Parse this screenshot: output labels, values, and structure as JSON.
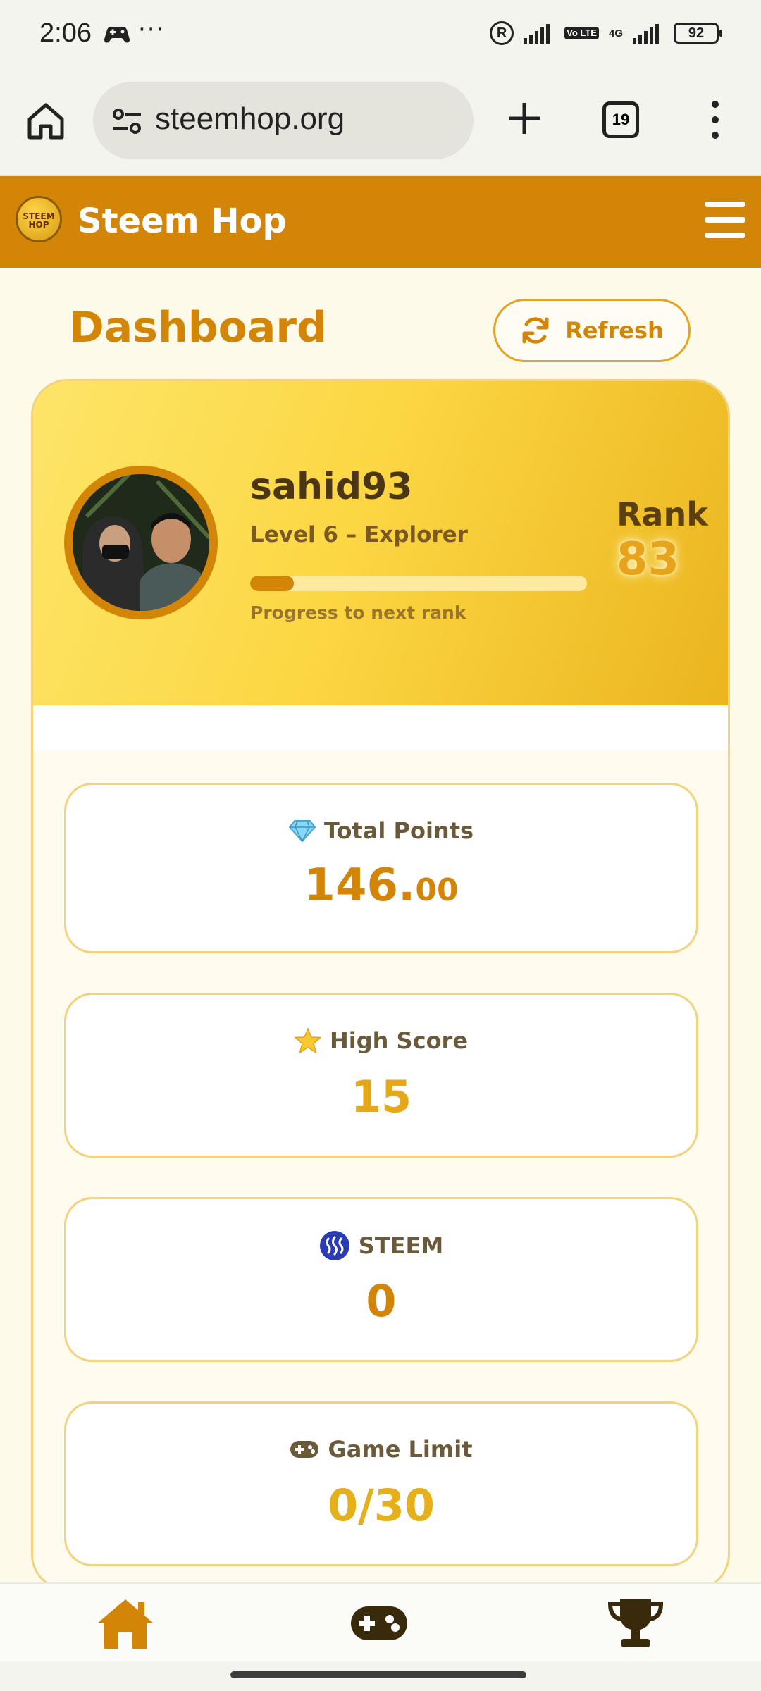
{
  "status_bar": {
    "time": "2:06",
    "dots": "···",
    "network": "4G",
    "volte": "Vo LTE",
    "battery": "92"
  },
  "browser": {
    "url": "steemhop.org",
    "tab_count": "19"
  },
  "app": {
    "title": "Steem Hop",
    "logo_text": "STEEM HOP",
    "brand_color": "#d38507"
  },
  "dashboard": {
    "title": "Dashboard",
    "refresh_label": "Refresh"
  },
  "profile": {
    "username": "sahid93",
    "level": "Level 6 – Explorer",
    "progress_label": "Progress to next rank",
    "progress_fraction": 0.13,
    "rank_label": "Rank",
    "rank_value": "83"
  },
  "stats": [
    {
      "icon": "diamond-icon",
      "label": "Total Points",
      "value_main": "146.",
      "value_decimals": "00",
      "color": "#d38507"
    },
    {
      "icon": "star-icon",
      "label": "High Score",
      "value": "15",
      "color": "#e6a81b"
    },
    {
      "icon": "steem-icon",
      "label": "STEEM",
      "value": "0",
      "color": "#d38507"
    },
    {
      "icon": "gamepad-icon",
      "label": "Game Limit",
      "value": "0/30",
      "color": "#e6b01b"
    }
  ],
  "nav": [
    {
      "icon": "home-icon",
      "active": true
    },
    {
      "icon": "gamepad-icon",
      "active": false
    },
    {
      "icon": "trophy-icon",
      "active": false
    }
  ]
}
